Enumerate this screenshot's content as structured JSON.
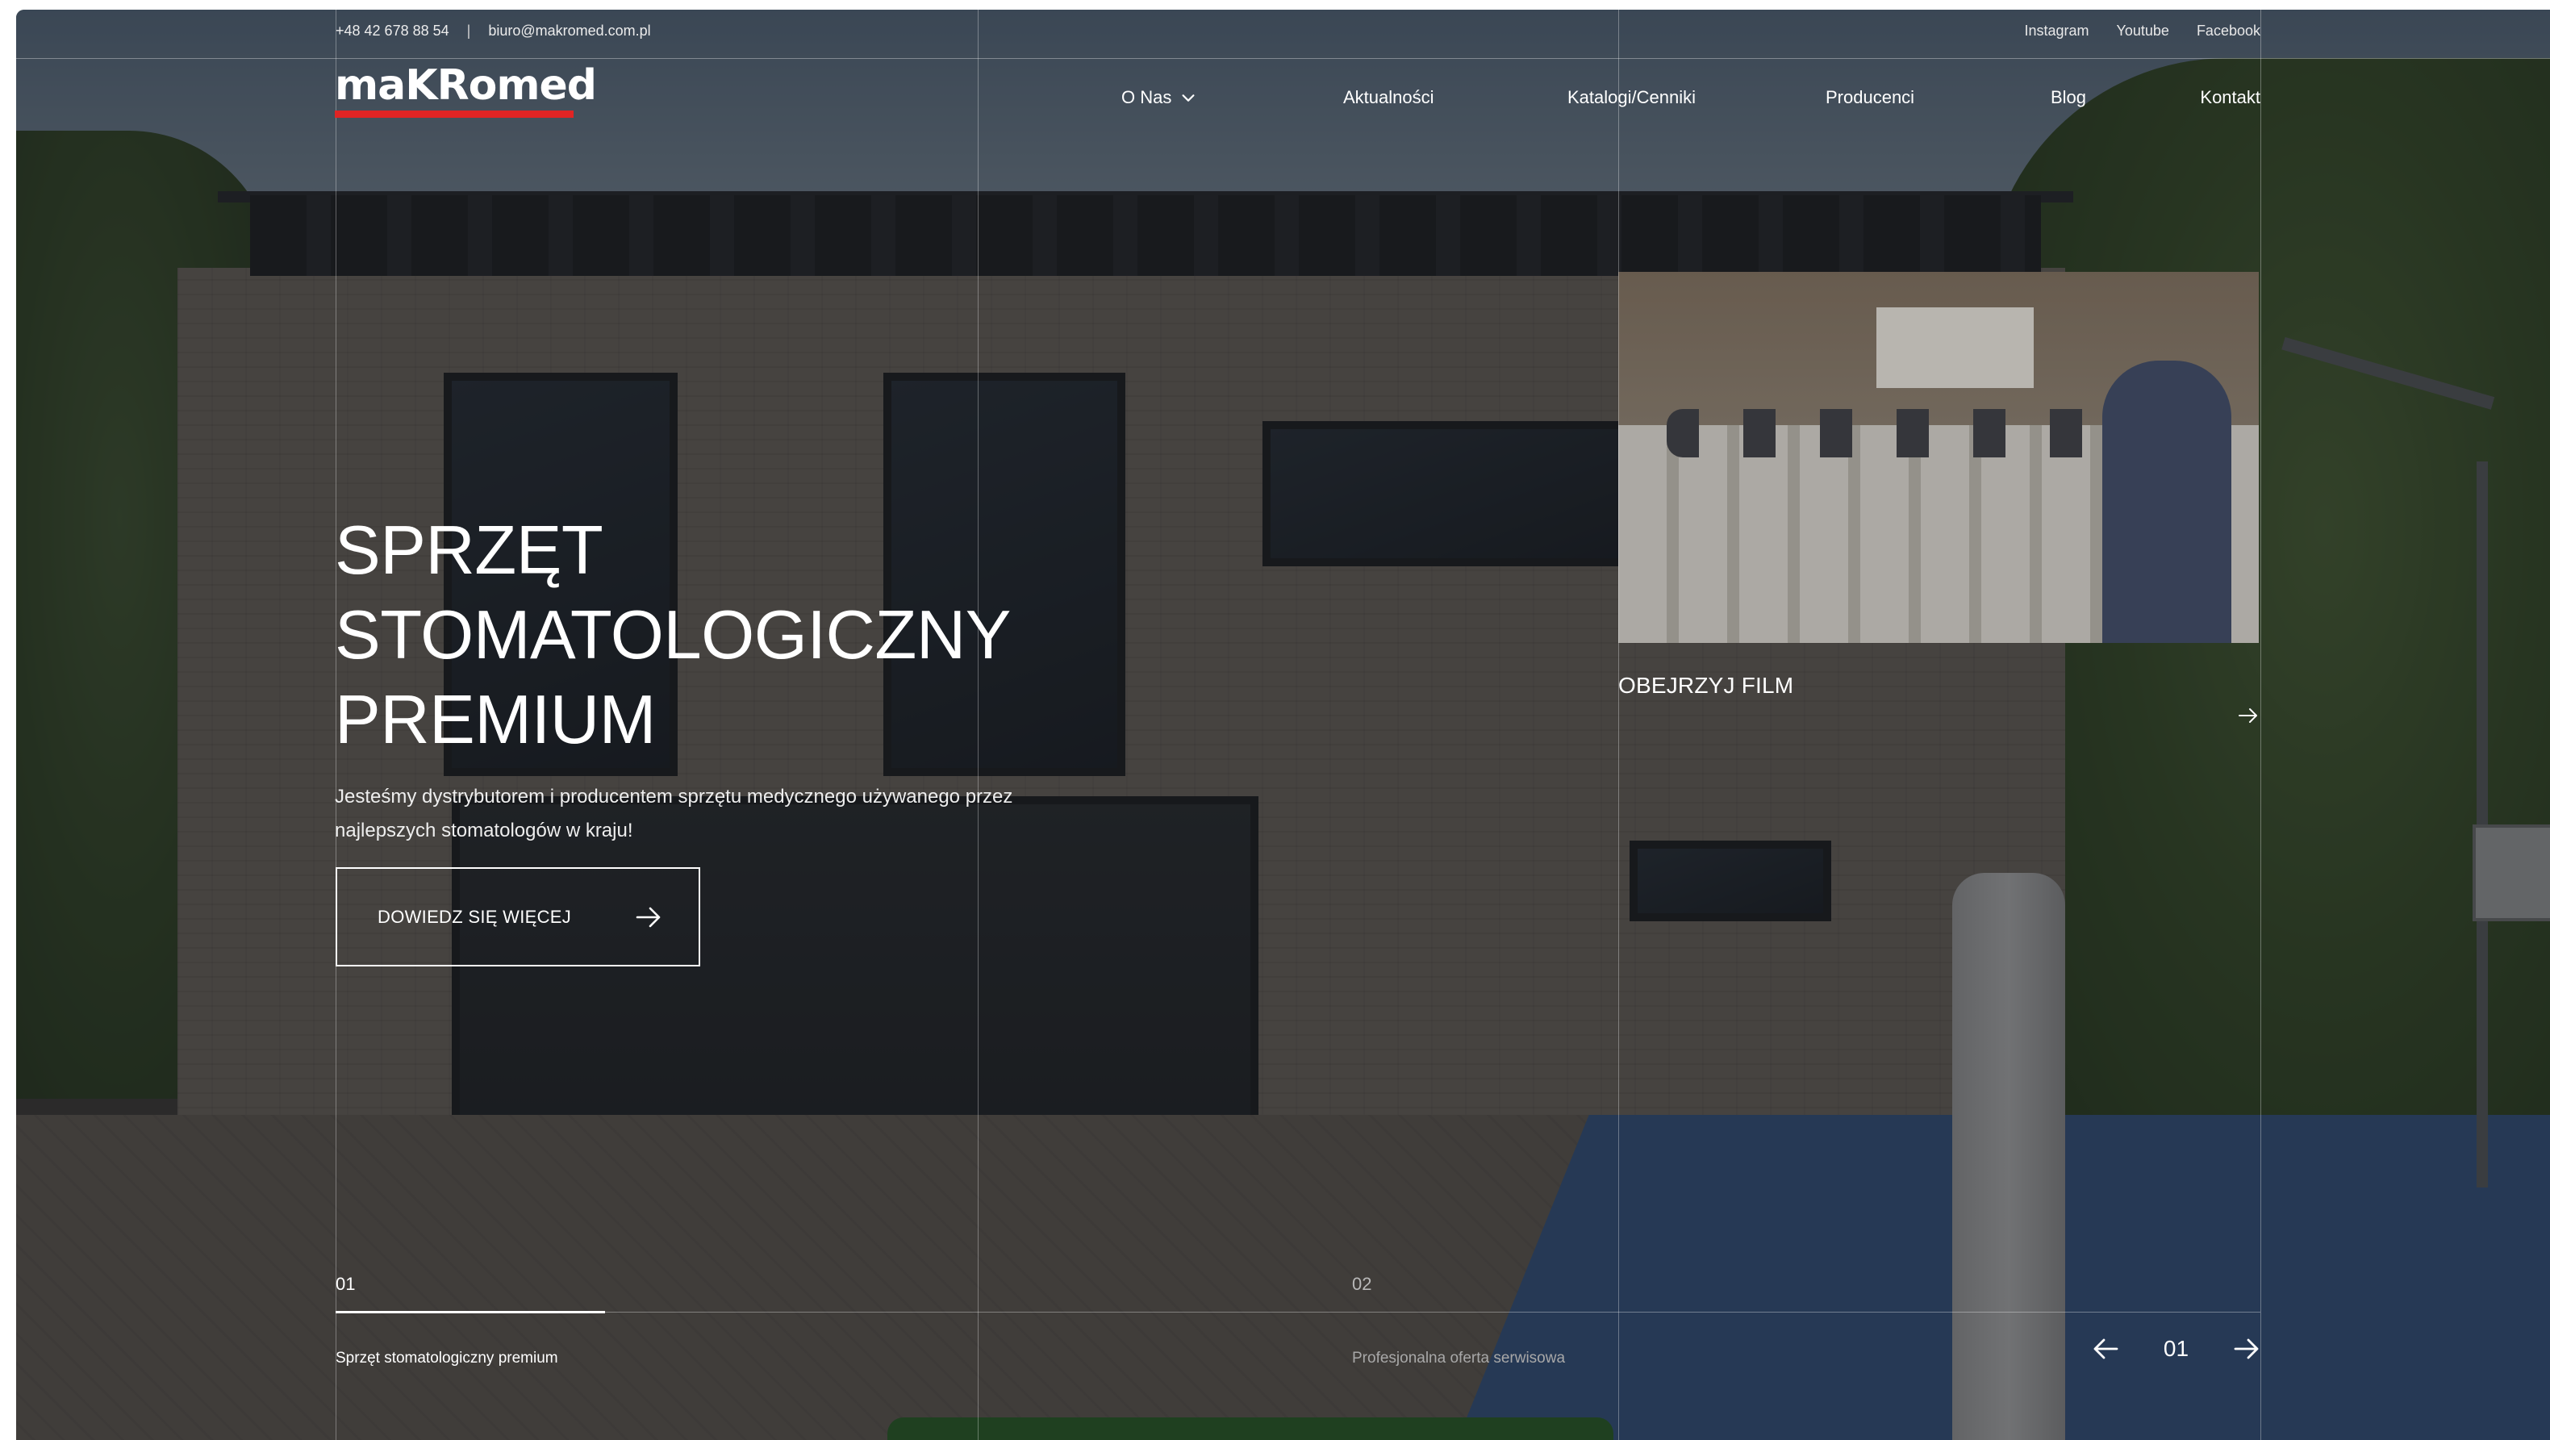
{
  "topbar": {
    "phone": "+48 42 678 88 54",
    "separator": "|",
    "email": "biuro@makromed.com.pl",
    "social": [
      "Instagram",
      "Youtube",
      "Facebook"
    ]
  },
  "logo": {
    "text": "maKRomed",
    "accent_color": "#e02424"
  },
  "nav": {
    "items": [
      {
        "label": "O Nas",
        "has_dropdown": true,
        "icon": "chevron-down-icon"
      },
      {
        "label": "Aktualności"
      },
      {
        "label": "Katalogi/Cenniki"
      },
      {
        "label": "Producenci"
      },
      {
        "label": "Blog"
      },
      {
        "label": "Kontakt"
      }
    ]
  },
  "hero": {
    "title_lines": [
      "SPRZĘT",
      "STOMATOLOGICZNY",
      "PREMIUM"
    ],
    "description": "Jesteśmy dystrybutorem i producentem sprzętu medycznego używanego przez najlepszych stomatologów w kraju!",
    "cta_label": "DOWIEDZ SIĘ WIĘCEJ",
    "cta_icon": "arrow-right-icon"
  },
  "video": {
    "label": "OBEJRZYJ FILM",
    "icon": "arrow-right-icon"
  },
  "slider": {
    "slides": [
      {
        "number": "01",
        "caption": "Sprzęt stomatologiczny premium",
        "active": true
      },
      {
        "number": "02",
        "caption": "Profesjonalna oferta serwisowa",
        "active": false
      }
    ],
    "current": "01",
    "progress": 0.14,
    "prev_icon": "arrow-left-icon",
    "next_icon": "arrow-right-icon"
  },
  "colors": {
    "overlay": "#14161a",
    "text": "#ffffff",
    "brand_red": "#e02424"
  }
}
